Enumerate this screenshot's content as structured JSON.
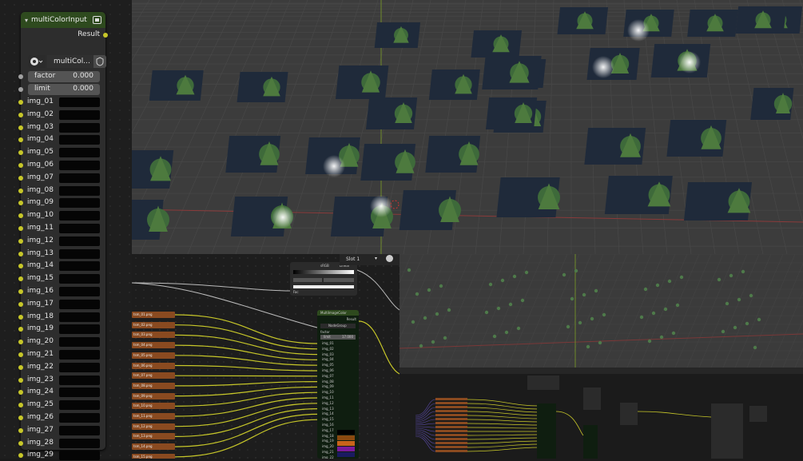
{
  "node": {
    "title": "multiColorInput",
    "result_label": "Result",
    "nodegroup_name": "multiCol...",
    "factor": {
      "label": "factor",
      "value": "0.000"
    },
    "limit": {
      "label": "limit",
      "value": "0.000"
    },
    "image_inputs": [
      "img_01",
      "img_02",
      "img_03",
      "img_04",
      "img_05",
      "img_06",
      "img_07",
      "img_08",
      "img_09",
      "img_10",
      "img_11",
      "img_12",
      "img_13",
      "img_14",
      "img_15",
      "img_16",
      "img_17",
      "img_18",
      "img_19",
      "img_20",
      "img_21",
      "img_22",
      "img_23",
      "img_24",
      "img_25",
      "img_26",
      "img_27",
      "img_28",
      "img_29"
    ]
  },
  "lower_editor": {
    "slot_label": "Slot 1",
    "color_space": "sRGB",
    "interpolation": "Linear",
    "inner_node_title": "MultiImageColor",
    "inner_result": "Result",
    "inner_nodegroup": "NodeGroup",
    "inner_limit_label": "limit",
    "inner_limit_value": "17.000",
    "inner_inputs": [
      "img_01",
      "img_02",
      "img_03",
      "img_04",
      "img_05",
      "img_06",
      "img_07",
      "img_08",
      "img_09",
      "img_10",
      "img_11",
      "img_12",
      "img_13",
      "img_14",
      "img_15",
      "img_16",
      "img_17",
      "img_18",
      "img_19",
      "img_20",
      "img_21",
      "img_22"
    ],
    "texture_nodes": [
      "tsm_01.png",
      "tsm_02.png",
      "tsm_03.png",
      "tsm_04.png",
      "tsm_05.png",
      "tsm_06.png",
      "tsm_07.png",
      "tsm_08.png",
      "tsm_09.png",
      "tsm_10.png",
      "tsm_11.png",
      "tsm_12.png",
      "tsm_13.png",
      "tsm_14.png",
      "tsm_15.png"
    ],
    "fac_label": "Fac",
    "factor_label": "factor"
  },
  "colors": {
    "node_header": "#2e4a1e",
    "socket_yellow": "#c7c729",
    "socket_grey": "#a1a1a1",
    "texture_node": "#8a4a20",
    "viewport_bg": "#3a3a3a"
  }
}
